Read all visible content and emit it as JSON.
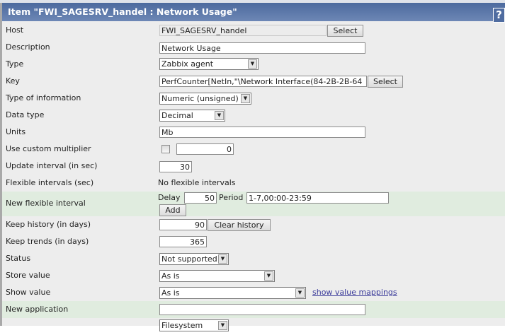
{
  "header": {
    "title": "Item \"FWI_SAGESRV_handel : Network Usage\"",
    "help_label": "?"
  },
  "fields": {
    "host": {
      "label": "Host",
      "value": "FWI_SAGESRV_handel",
      "button": "Select"
    },
    "description": {
      "label": "Description",
      "value": "Network Usage"
    },
    "type": {
      "label": "Type",
      "value": "Zabbix agent"
    },
    "key": {
      "label": "Key",
      "value": "PerfCounter[NetIn,\"\\Network Interface(84-2B-2B-64",
      "button": "Select"
    },
    "type_info": {
      "label": "Type of information",
      "value": "Numeric (unsigned)"
    },
    "data_type": {
      "label": "Data type",
      "value": "Decimal"
    },
    "units": {
      "label": "Units",
      "value": "Mb"
    },
    "multiplier": {
      "label": "Use custom multiplier",
      "value": "0"
    },
    "update": {
      "label": "Update interval (in sec)",
      "value": "30"
    },
    "flex": {
      "label": "Flexible intervals (sec)",
      "value": "No flexible intervals"
    },
    "new_flex": {
      "label": "New flexible interval",
      "delay_label": "Delay",
      "delay": "50",
      "period_label": "Period",
      "period": "1-7,00:00-23:59",
      "add": "Add"
    },
    "history": {
      "label": "Keep history (in days)",
      "value": "90",
      "button": "Clear history"
    },
    "trends": {
      "label": "Keep trends (in days)",
      "value": "365"
    },
    "status": {
      "label": "Status",
      "value": "Not supported"
    },
    "store": {
      "label": "Store value",
      "value": "As is"
    },
    "show": {
      "label": "Show value",
      "value": "As is",
      "link": "show value mappings"
    },
    "new_app": {
      "label": "New application",
      "value": ""
    },
    "applications": {
      "value": "Filesystem"
    }
  }
}
